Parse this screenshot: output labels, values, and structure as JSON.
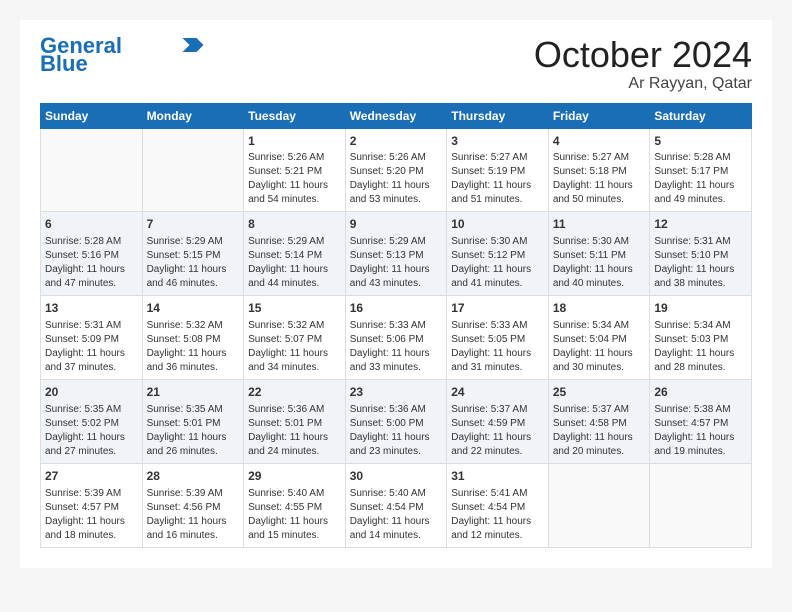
{
  "header": {
    "logo_line1": "General",
    "logo_line2": "Blue",
    "month_year": "October 2024",
    "location": "Ar Rayyan, Qatar"
  },
  "weekdays": [
    "Sunday",
    "Monday",
    "Tuesday",
    "Wednesday",
    "Thursday",
    "Friday",
    "Saturday"
  ],
  "weeks": [
    [
      {
        "day": "",
        "content": ""
      },
      {
        "day": "",
        "content": ""
      },
      {
        "day": "1",
        "content": "Sunrise: 5:26 AM\nSunset: 5:21 PM\nDaylight: 11 hours and 54 minutes."
      },
      {
        "day": "2",
        "content": "Sunrise: 5:26 AM\nSunset: 5:20 PM\nDaylight: 11 hours and 53 minutes."
      },
      {
        "day": "3",
        "content": "Sunrise: 5:27 AM\nSunset: 5:19 PM\nDaylight: 11 hours and 51 minutes."
      },
      {
        "day": "4",
        "content": "Sunrise: 5:27 AM\nSunset: 5:18 PM\nDaylight: 11 hours and 50 minutes."
      },
      {
        "day": "5",
        "content": "Sunrise: 5:28 AM\nSunset: 5:17 PM\nDaylight: 11 hours and 49 minutes."
      }
    ],
    [
      {
        "day": "6",
        "content": "Sunrise: 5:28 AM\nSunset: 5:16 PM\nDaylight: 11 hours and 47 minutes."
      },
      {
        "day": "7",
        "content": "Sunrise: 5:29 AM\nSunset: 5:15 PM\nDaylight: 11 hours and 46 minutes."
      },
      {
        "day": "8",
        "content": "Sunrise: 5:29 AM\nSunset: 5:14 PM\nDaylight: 11 hours and 44 minutes."
      },
      {
        "day": "9",
        "content": "Sunrise: 5:29 AM\nSunset: 5:13 PM\nDaylight: 11 hours and 43 minutes."
      },
      {
        "day": "10",
        "content": "Sunrise: 5:30 AM\nSunset: 5:12 PM\nDaylight: 11 hours and 41 minutes."
      },
      {
        "day": "11",
        "content": "Sunrise: 5:30 AM\nSunset: 5:11 PM\nDaylight: 11 hours and 40 minutes."
      },
      {
        "day": "12",
        "content": "Sunrise: 5:31 AM\nSunset: 5:10 PM\nDaylight: 11 hours and 38 minutes."
      }
    ],
    [
      {
        "day": "13",
        "content": "Sunrise: 5:31 AM\nSunset: 5:09 PM\nDaylight: 11 hours and 37 minutes."
      },
      {
        "day": "14",
        "content": "Sunrise: 5:32 AM\nSunset: 5:08 PM\nDaylight: 11 hours and 36 minutes."
      },
      {
        "day": "15",
        "content": "Sunrise: 5:32 AM\nSunset: 5:07 PM\nDaylight: 11 hours and 34 minutes."
      },
      {
        "day": "16",
        "content": "Sunrise: 5:33 AM\nSunset: 5:06 PM\nDaylight: 11 hours and 33 minutes."
      },
      {
        "day": "17",
        "content": "Sunrise: 5:33 AM\nSunset: 5:05 PM\nDaylight: 11 hours and 31 minutes."
      },
      {
        "day": "18",
        "content": "Sunrise: 5:34 AM\nSunset: 5:04 PM\nDaylight: 11 hours and 30 minutes."
      },
      {
        "day": "19",
        "content": "Sunrise: 5:34 AM\nSunset: 5:03 PM\nDaylight: 11 hours and 28 minutes."
      }
    ],
    [
      {
        "day": "20",
        "content": "Sunrise: 5:35 AM\nSunset: 5:02 PM\nDaylight: 11 hours and 27 minutes."
      },
      {
        "day": "21",
        "content": "Sunrise: 5:35 AM\nSunset: 5:01 PM\nDaylight: 11 hours and 26 minutes."
      },
      {
        "day": "22",
        "content": "Sunrise: 5:36 AM\nSunset: 5:01 PM\nDaylight: 11 hours and 24 minutes."
      },
      {
        "day": "23",
        "content": "Sunrise: 5:36 AM\nSunset: 5:00 PM\nDaylight: 11 hours and 23 minutes."
      },
      {
        "day": "24",
        "content": "Sunrise: 5:37 AM\nSunset: 4:59 PM\nDaylight: 11 hours and 22 minutes."
      },
      {
        "day": "25",
        "content": "Sunrise: 5:37 AM\nSunset: 4:58 PM\nDaylight: 11 hours and 20 minutes."
      },
      {
        "day": "26",
        "content": "Sunrise: 5:38 AM\nSunset: 4:57 PM\nDaylight: 11 hours and 19 minutes."
      }
    ],
    [
      {
        "day": "27",
        "content": "Sunrise: 5:39 AM\nSunset: 4:57 PM\nDaylight: 11 hours and 18 minutes."
      },
      {
        "day": "28",
        "content": "Sunrise: 5:39 AM\nSunset: 4:56 PM\nDaylight: 11 hours and 16 minutes."
      },
      {
        "day": "29",
        "content": "Sunrise: 5:40 AM\nSunset: 4:55 PM\nDaylight: 11 hours and 15 minutes."
      },
      {
        "day": "30",
        "content": "Sunrise: 5:40 AM\nSunset: 4:54 PM\nDaylight: 11 hours and 14 minutes."
      },
      {
        "day": "31",
        "content": "Sunrise: 5:41 AM\nSunset: 4:54 PM\nDaylight: 11 hours and 12 minutes."
      },
      {
        "day": "",
        "content": ""
      },
      {
        "day": "",
        "content": ""
      }
    ]
  ]
}
